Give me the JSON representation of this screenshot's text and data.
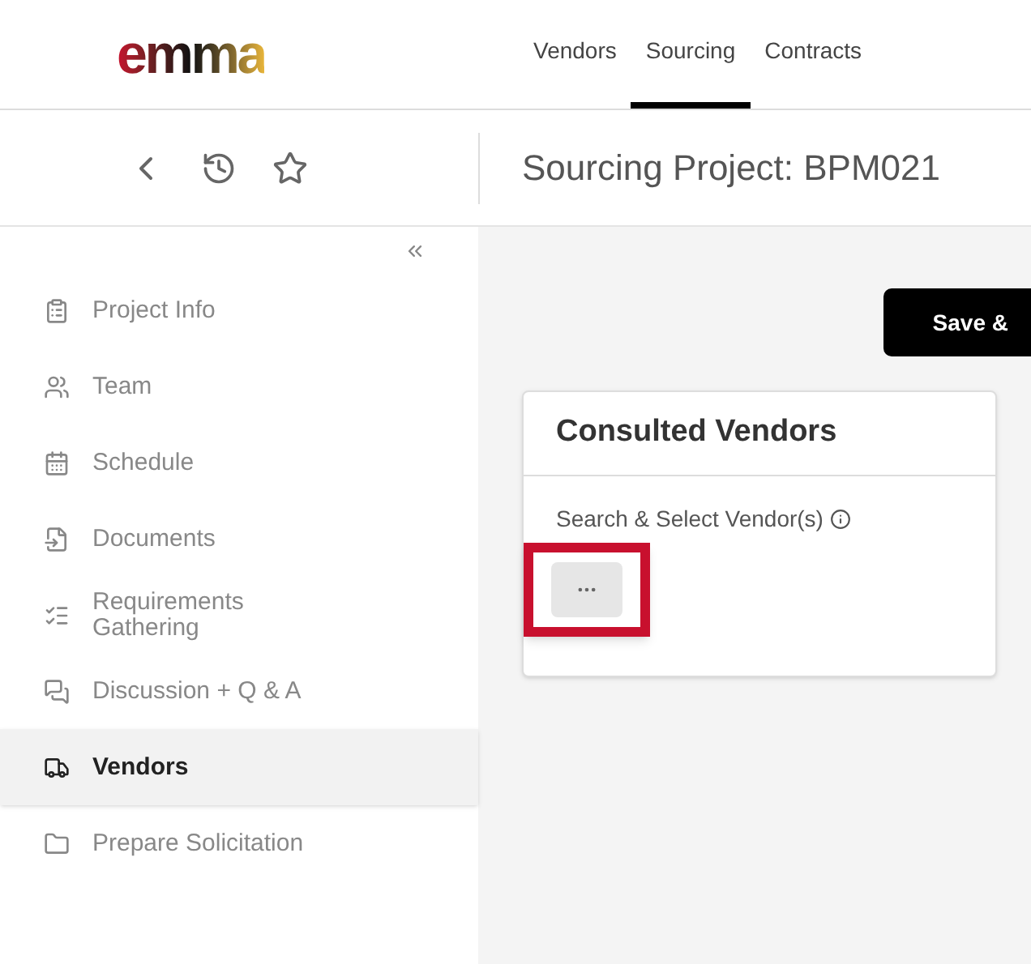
{
  "logo": {
    "text": "emma"
  },
  "top_nav": [
    {
      "label": "Vendors",
      "selected": false
    },
    {
      "label": "Sourcing",
      "selected": true
    },
    {
      "label": "Contracts",
      "selected": false
    }
  ],
  "page_title": "Sourcing Project: BPM021",
  "sidebar": {
    "items": [
      {
        "label": "Project Info",
        "selected": false
      },
      {
        "label": "Team",
        "selected": false
      },
      {
        "label": "Schedule",
        "selected": false
      },
      {
        "label": "Documents",
        "selected": false
      },
      {
        "label": "Requirements Gathering",
        "selected": false
      },
      {
        "label": "Discussion + Q & A",
        "selected": false
      },
      {
        "label": "Vendors",
        "selected": true
      },
      {
        "label": "Prepare Solicitation",
        "selected": false
      }
    ]
  },
  "save_button": "Save &",
  "card": {
    "title": "Consulted Vendors",
    "field_label": "Search & Select Vendor(s)",
    "highlighted": true
  }
}
